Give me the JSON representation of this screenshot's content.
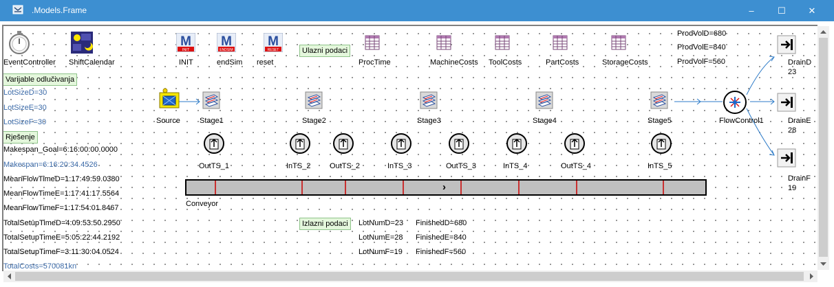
{
  "window": {
    "title": ".Models.Frame",
    "minimize": "–",
    "maximize": "☐",
    "close": "✕"
  },
  "colors": {
    "titlebar": "#3d8fd1",
    "blue_text": "#3b6aa8",
    "green_label_bg": "#e4f7dc",
    "marker": "#cc0000"
  },
  "top_objects": {
    "event_controller": "EventController",
    "shift_calendar": "ShiftCalendar",
    "init": "INIT",
    "init_badge": "INIT",
    "endsim": "endSim",
    "endsim_badge": "ENDSIM",
    "reset": "reset",
    "reset_badge": "RESET",
    "ulazni": "Ulazni podaci",
    "proctime": "ProcTime",
    "machinecosts": "MachineCosts",
    "toolcosts": "ToolCosts",
    "partcosts": "PartCosts",
    "storagecosts": "StorageCosts"
  },
  "prodvol": {
    "d": "ProdVolD=680",
    "e": "ProdVolE=840",
    "f": "ProdVolF=560"
  },
  "left_panel": {
    "varijable": "Varijable odlučivanja",
    "lotD": "LotSizeD=30",
    "lotE": "LotSizeE=30",
    "lotF": "LotSizeF=30",
    "rjesenje": "Rješenje",
    "makespan_goal": "Makespan_Goal=6:16:00:00.0000",
    "makespan": "Makespan=6:16:20:34.4526",
    "mftD": "MeanFlowTimeD=1:17:49:59.0380",
    "mftE": "MeanFlowTimeE=1:17:41:17.5564",
    "mftF": "MeanFlowTimeF=1:17:54:01.8467",
    "tstD": "TotalSetupTimeD=4:09:53:50.2950",
    "tstE": "TotalSetupTimeE=5:05:22:44.2192",
    "tstF": "TotalSetupTimeF=3:11:30:04.0524",
    "totalcosts": "TotalCosts=570081kn"
  },
  "flow": {
    "source": "Source",
    "stage1": "Stage1",
    "stage2": "Stage2",
    "stage3": "Stage3",
    "stage4": "Stage4",
    "stage5": "Stage5",
    "flowcontrol": "FlowControl1",
    "drainD": "DrainD",
    "drainD_count": "23",
    "drainE": "DrainE",
    "drainE_count": "28",
    "drainF": "DrainF",
    "drainF_count": "19"
  },
  "buffers": {
    "b1": "OutTS_1",
    "b2": "InTS_2",
    "b3": "OutTS_2",
    "b4": "InTS_3",
    "b5": "OutTS_3",
    "b6": "InTS_4",
    "b7": "OutTS_4",
    "b8": "InTS_5"
  },
  "conveyor": {
    "label": "Conveyor",
    "arrow": "›"
  },
  "output": {
    "izlazni": "Izlazni podaci",
    "lotNumD": "LotNumD=23",
    "lotNumE": "LotNumE=28",
    "lotNumF": "LotNumF=19",
    "finishedD": "FinishedD=680",
    "finishedE": "FinishedE=840",
    "finishedF": "FinishedF=560"
  }
}
